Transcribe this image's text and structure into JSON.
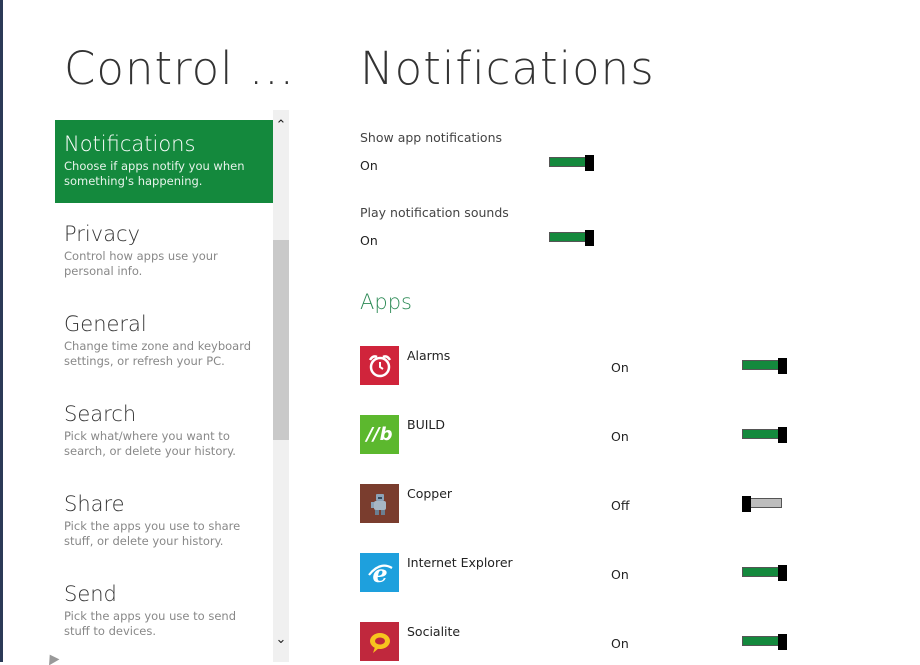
{
  "sidebar": {
    "title": "Control ...",
    "items": [
      {
        "title": "Notifications",
        "desc": "Choose if apps notify you when something's happening."
      },
      {
        "title": "Privacy",
        "desc": "Control how apps use your personal info."
      },
      {
        "title": "General",
        "desc": "Change time zone and keyboard settings, or refresh your PC."
      },
      {
        "title": "Search",
        "desc": "Pick what/where you want to search, or delete your history."
      },
      {
        "title": "Share",
        "desc": "Pick the apps you use to share stuff, or delete your history."
      },
      {
        "title": "Send",
        "desc": "Pick the apps you use to send stuff to devices."
      }
    ]
  },
  "main": {
    "title": "Notifications",
    "settings": [
      {
        "label": "Show app notifications",
        "state": "On",
        "on": true
      },
      {
        "label": "Play notification sounds",
        "state": "On",
        "on": true
      }
    ],
    "apps_heading": "Apps",
    "apps": [
      {
        "name": "Alarms",
        "state": "On",
        "on": true,
        "icon": "alarm-clock-icon",
        "color": "#d0243b"
      },
      {
        "name": "BUILD",
        "state": "On",
        "on": true,
        "icon": "build-icon",
        "color": "#5cb82e",
        "tile_text": "//b"
      },
      {
        "name": "Copper",
        "state": "Off",
        "on": false,
        "icon": "copper-robot-icon",
        "color": "#7a3d2e"
      },
      {
        "name": "Internet Explorer",
        "state": "On",
        "on": true,
        "icon": "internet-explorer-icon",
        "color": "#1ea0dd"
      },
      {
        "name": "Socialite",
        "state": "On",
        "on": true,
        "icon": "socialite-icon",
        "color": "#c0283d"
      }
    ]
  },
  "colors": {
    "accent": "#14893d",
    "apps_heading": "#2e8b57"
  }
}
